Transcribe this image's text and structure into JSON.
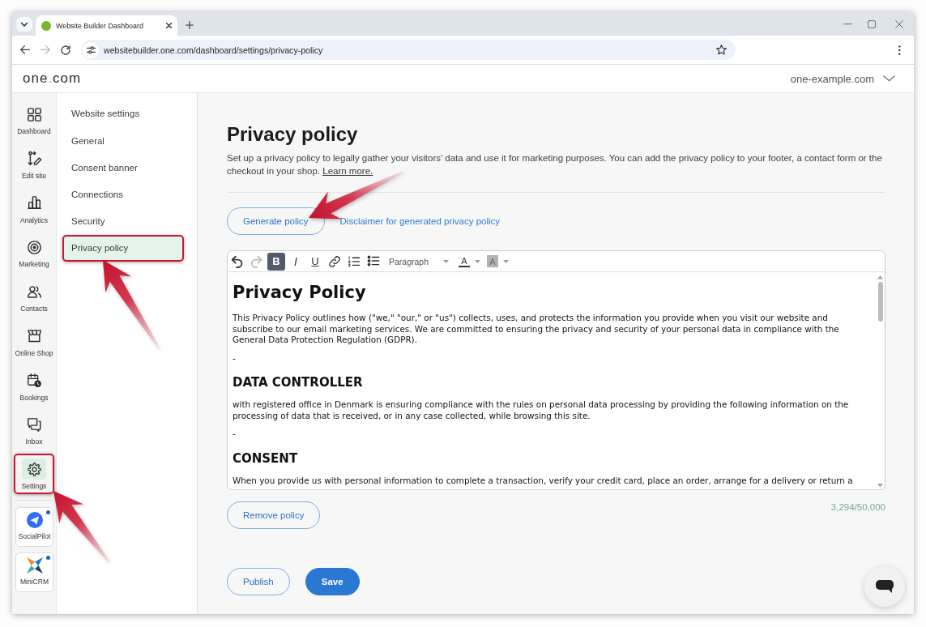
{
  "browser": {
    "tabs": [
      {
        "title": "Website Builder Dashboard",
        "selected": true
      }
    ],
    "nav_buttons": [
      {
        "kind": "back",
        "disabled": false
      },
      {
        "kind": "forward",
        "disabled": true
      },
      {
        "kind": "reload",
        "disabled": false
      }
    ],
    "url": "websitebuilder.one.com/dashboard/settings/privacy-policy"
  },
  "header": {
    "logo": "one.com",
    "site": "one-example.com"
  },
  "rail": {
    "items": [
      {
        "kind": "dashboard",
        "label": "Dashboard",
        "selected": false,
        "highlighted": false,
        "arrow": false
      },
      {
        "kind": "editor",
        "label": "Edit site",
        "selected": false,
        "highlighted": false,
        "arrow": false
      },
      {
        "kind": "analytics",
        "label": "Analytics",
        "selected": false,
        "highlighted": false,
        "arrow": false
      },
      {
        "kind": "marketing",
        "label": "Marketing",
        "selected": false,
        "highlighted": false,
        "arrow": false
      },
      {
        "kind": "contacts",
        "label": "Contacts",
        "selected": false,
        "highlighted": false,
        "arrow": false
      },
      {
        "kind": "shop",
        "label": "Online Shop",
        "selected": false,
        "highlighted": false,
        "arrow": false
      },
      {
        "kind": "bookings",
        "label": "Bookings",
        "selected": false,
        "highlighted": false,
        "arrow": false
      },
      {
        "kind": "inbox",
        "label": "Inbox",
        "selected": false,
        "highlighted": false,
        "arrow": false
      },
      {
        "kind": "settings",
        "label": "Settings",
        "selected": true,
        "highlighted": true,
        "arrow": true
      }
    ],
    "apps": [
      {
        "kind": "socialpilot",
        "label": "SocialPilot",
        "notification_dot": true
      },
      {
        "kind": "minicrm",
        "label": "MiniCRM",
        "notification_dot": true
      }
    ]
  },
  "settings_nav": {
    "heading": "Website settings",
    "items": [
      {
        "label": "General",
        "selected": false,
        "highlighted": false,
        "arrow": false
      },
      {
        "label": "Consent banner",
        "selected": false,
        "highlighted": false,
        "arrow": false
      },
      {
        "label": "Connections",
        "selected": false,
        "highlighted": false,
        "arrow": false
      },
      {
        "label": "Security",
        "selected": false,
        "highlighted": false,
        "arrow": false
      },
      {
        "label": "Privacy policy",
        "selected": true,
        "highlighted": true,
        "arrow": true
      }
    ]
  },
  "page": {
    "title": "Privacy policy",
    "description": "Set up a privacy policy to legally gather your visitors’ data and use it for marketing purposes. You can add the privacy policy to your footer, a contact form or the checkout in your shop.",
    "learn_more": "Learn more.",
    "generate_button": {
      "label": "Generate policy",
      "arrow": true
    },
    "disclaimer_link": "Disclaimer for generated privacy policy",
    "editor": {
      "toolbar": [
        {
          "kind": "undo",
          "active": false,
          "disabled": false
        },
        {
          "kind": "redo",
          "active": false,
          "disabled": true
        },
        {
          "kind": "bold",
          "label": "B",
          "active": true,
          "disabled": false
        },
        {
          "kind": "italic",
          "label": "I",
          "active": false,
          "disabled": false
        },
        {
          "kind": "underline",
          "label": "U",
          "active": false,
          "disabled": false
        },
        {
          "kind": "link",
          "active": false,
          "disabled": false
        },
        {
          "kind": "numbered_list",
          "active": false,
          "disabled": false
        },
        {
          "kind": "bulleted_list",
          "active": false,
          "disabled": false
        },
        {
          "kind": "block_format",
          "label": "Paragraph",
          "active": false,
          "disabled": false
        },
        {
          "kind": "text_color",
          "label": "A",
          "active": false,
          "disabled": false
        },
        {
          "kind": "highlight_color",
          "label": "A",
          "active": false,
          "disabled": false
        }
      ],
      "content": [
        {
          "kind": "h1",
          "text": "Privacy Policy"
        },
        {
          "kind": "p",
          "text": "This Privacy Policy outlines how (\"we,\" \"our,\" or \"us\") collects, uses, and protects the information you provide when you visit our website and subscribe to our email marketing services. We are committed to ensuring the privacy and security of your personal data in compliance with the General Data Protection Regulation (GDPR)."
        },
        {
          "kind": "p",
          "text": "-"
        },
        {
          "kind": "h2",
          "text": "DATA CONTROLLER"
        },
        {
          "kind": "p",
          "text": "with registered office in Denmark is ensuring compliance with the rules on personal data processing by providing the following information on the processing of data that is received, or in any case collected, while browsing this site."
        },
        {
          "kind": "p",
          "text": "-"
        },
        {
          "kind": "h2",
          "text": "CONSENT"
        },
        {
          "kind": "p",
          "text": "When you provide us with personal information to complete a transaction, verify your credit card, place an order, arrange for a delivery or return a"
        }
      ]
    },
    "remove_button": "Remove policy",
    "character_count": "3,294/50,000",
    "actions": [
      {
        "kind": "outline",
        "label": "Publish"
      },
      {
        "kind": "primary",
        "label": "Save"
      }
    ]
  }
}
